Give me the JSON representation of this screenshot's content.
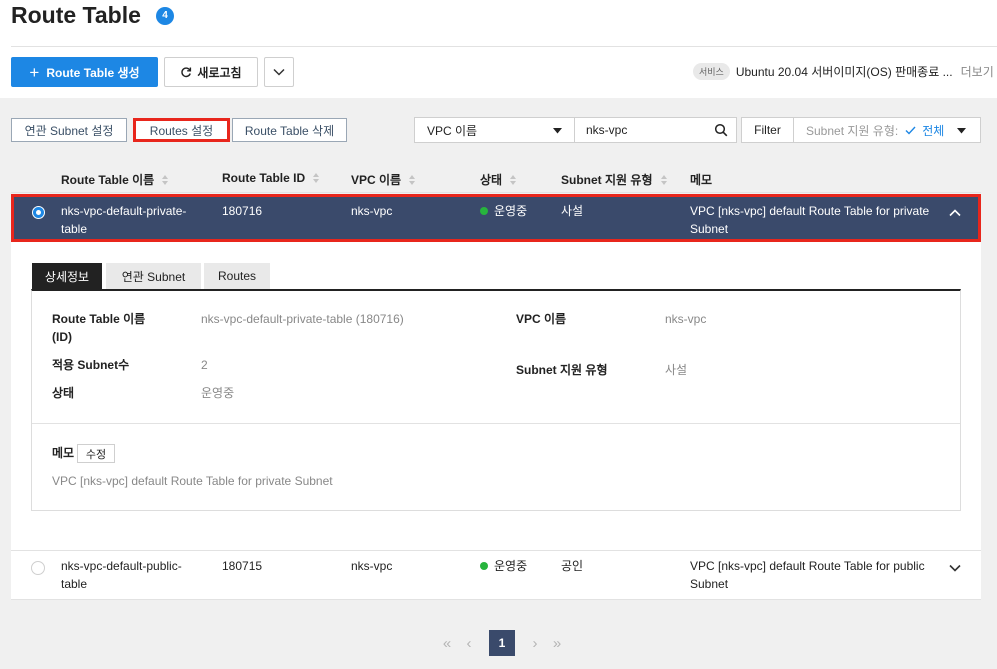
{
  "header": {
    "title": "Route Table",
    "count": "4",
    "create_label": "Route Table 생성",
    "refresh_label": "새로고침",
    "notice_tag": "서비스",
    "notice_text": "Ubuntu 20.04 서버이미지(OS) 판매종료 ...",
    "notice_more": "더보기"
  },
  "toolbar": {
    "subnet_settings": "연관 Subnet 설정",
    "routes_settings": "Routes 설정",
    "delete": "Route Table 삭제",
    "search_field": "VPC 이름",
    "search_value": "nks-vpc",
    "filter_label": "Filter",
    "filter_type": "Subnet 지원 유형:",
    "filter_value": "전체"
  },
  "table": {
    "columns": [
      "Route Table 이름",
      "Route Table ID",
      "VPC 이름",
      "상태",
      "Subnet 지원 유형",
      "메모"
    ],
    "rows": [
      {
        "name_line1": "nks-vpc-default-private-",
        "name_line2": "table",
        "id": "180716",
        "vpc": "nks-vpc",
        "status": "운영중",
        "subnet_type": "사설",
        "memo_line1": "VPC [nks-vpc] default Route Table for private",
        "memo_line2": "Subnet",
        "selected": true
      },
      {
        "name_line1": "nks-vpc-default-public-",
        "name_line2": "table",
        "id": "180715",
        "vpc": "nks-vpc",
        "status": "운영중",
        "subnet_type": "공인",
        "memo_line1": "VPC [nks-vpc] default Route Table for public",
        "memo_line2": "Subnet",
        "selected": false
      }
    ]
  },
  "detail": {
    "tabs": [
      "상세정보",
      "연관 Subnet",
      "Routes"
    ],
    "name_label_line1": "Route Table 이름",
    "name_label_line2": "(ID)",
    "name_value": "nks-vpc-default-private-table (180716)",
    "subnet_count_label": "적용 Subnet수",
    "subnet_count_value": "2",
    "status_label": "상태",
    "status_value": "운영중",
    "vpc_label": "VPC 이름",
    "vpc_value": "nks-vpc",
    "subnet_type_label": "Subnet 지원 유형",
    "subnet_type_value": "사설",
    "memo_label": "메모",
    "memo_edit": "수정",
    "memo_value": "VPC [nks-vpc] default Route Table for private Subnet"
  },
  "pagination": {
    "current": "1"
  },
  "colors": {
    "accent": "#1d87e4",
    "selected_row": "#3a4a6b",
    "highlight": "#e8261c",
    "status_ok": "#27b43d"
  }
}
